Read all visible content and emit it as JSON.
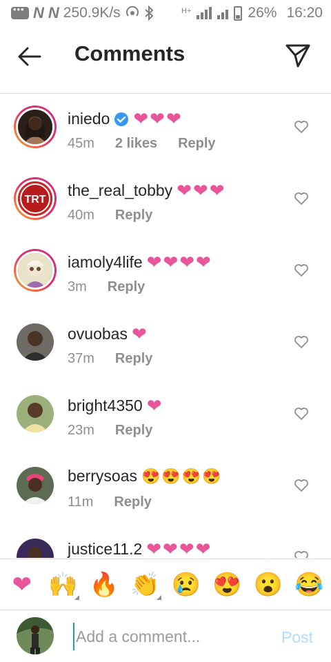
{
  "status_bar": {
    "speed": "250.9K/s",
    "battery": "26%",
    "time": "16:20",
    "network_letter": "N",
    "network_type": "H+"
  },
  "header": {
    "title": "Comments",
    "back_icon": "arrow-left-icon",
    "send_icon": "paper-plane-icon"
  },
  "comments": [
    {
      "username": "iniedo",
      "verified": true,
      "text": "❤❤❤",
      "time": "45m",
      "likes": "2 likes",
      "reply": "Reply"
    },
    {
      "username": "the_real_tobby",
      "verified": false,
      "text": "❤❤❤",
      "time": "40m",
      "likes": "",
      "reply": "Reply"
    },
    {
      "username": "iamoly4life",
      "verified": false,
      "text": "❤❤❤❤",
      "time": "3m",
      "likes": "",
      "reply": "Reply"
    },
    {
      "username": "ovuobas",
      "verified": false,
      "text": "❤",
      "time": "37m",
      "likes": "",
      "reply": "Reply"
    },
    {
      "username": "bright4350",
      "verified": false,
      "text": "❤",
      "time": "23m",
      "likes": "",
      "reply": "Reply"
    },
    {
      "username": "berrysoas",
      "verified": false,
      "text": "😍😍😍😍",
      "time": "11m",
      "likes": "",
      "reply": "Reply"
    },
    {
      "username": "justice11.2",
      "verified": false,
      "text": "❤❤❤❤",
      "time": "",
      "likes": "",
      "reply": ""
    }
  ],
  "trt_logo": "TRT",
  "emoji_bar": [
    "❤",
    "🙌",
    "🔥",
    "👏",
    "😢",
    "😍",
    "😮",
    "😂"
  ],
  "composer": {
    "placeholder": "Add a comment...",
    "post_label": "Post"
  },
  "colors": {
    "heart": "#e8559a",
    "verified": "#3897f0",
    "post_disabled": "#b3dbff",
    "cursor": "#1aa39e"
  }
}
